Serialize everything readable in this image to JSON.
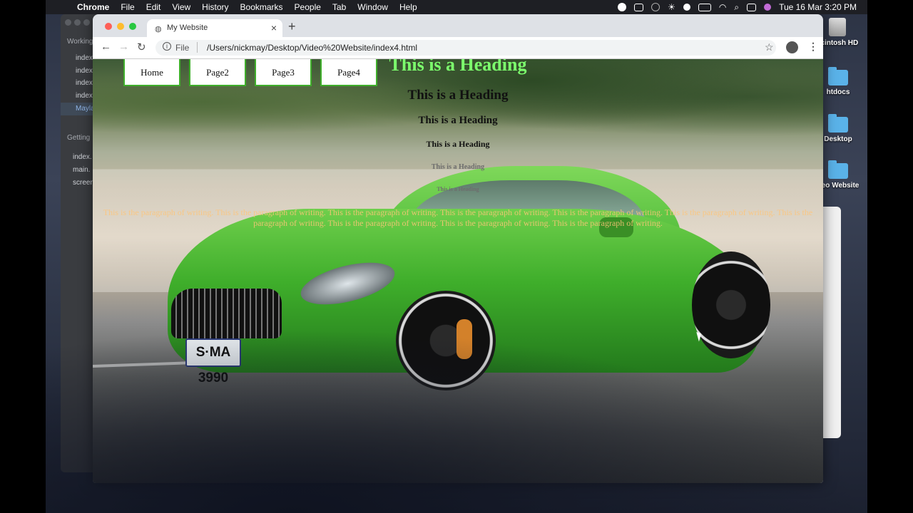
{
  "menubar": {
    "app": "Chrome",
    "menus": [
      "File",
      "Edit",
      "View",
      "History",
      "Bookmarks",
      "People",
      "Tab",
      "Window",
      "Help"
    ],
    "datetime": "Tue 16 Mar  3:20 PM"
  },
  "desktop_icons": [
    {
      "label": "acintosh HD",
      "type": "hdd-icon"
    },
    {
      "label": "htdocs",
      "type": "folder-icon"
    },
    {
      "label": "Desktop",
      "type": "folder-icon"
    },
    {
      "label": "deo Website",
      "type": "folder-icon"
    }
  ],
  "editor": {
    "section1": "Working",
    "files1": [
      "index",
      "index",
      "index",
      "index",
      "Mayla"
    ],
    "section2": "Getting",
    "files2": [
      "index.",
      "main.",
      "screen"
    ]
  },
  "chrome": {
    "tab_title": "My Website",
    "close_glyph": "×",
    "newtab_glyph": "+",
    "url_scheme": "File",
    "url": "/Users/nickmay/Desktop/Video%20Website/index4.html"
  },
  "page": {
    "nav": [
      "Home",
      "Page2",
      "Page3",
      "Page4"
    ],
    "headings": [
      "This is a Heading",
      "This is a Heading",
      "This is a Heading",
      "This is a Heading",
      "This is a Heading",
      "This is a Heading"
    ],
    "paragraph": "This is the paragraph of writing. This is the paragraph of writing. This is the paragraph of writing. This is the paragraph of writing. This is the paragraph of writing. This is the paragraph of writing. This is the paragraph of writing. This is the paragraph of writing. This is the paragraph of writing. This is the paragraph of writing.",
    "plate": "S·MA 3990",
    "colors": {
      "h1": "#7cff6d",
      "button_border": "#3fae2b",
      "paragraph": "#ffc478"
    }
  }
}
